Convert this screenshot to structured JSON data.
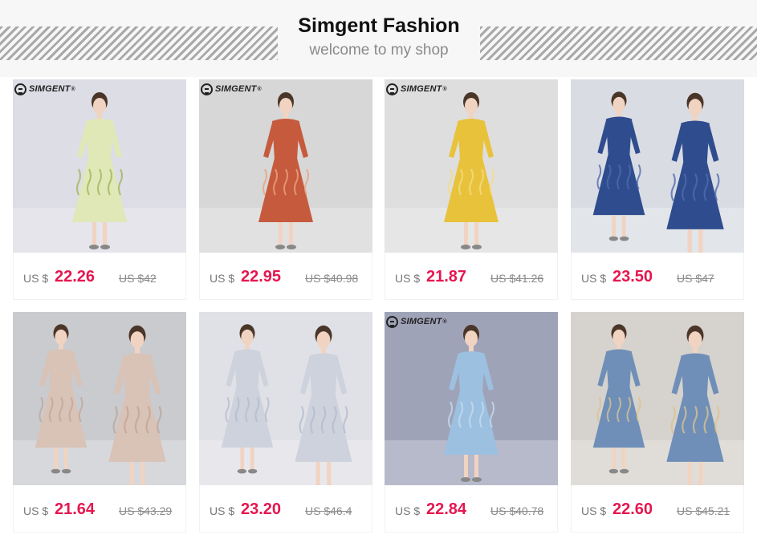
{
  "header": {
    "title": "Simgent Fashion",
    "subtitle": "welcome to my shop"
  },
  "brand_logo_text": "SIMGENT",
  "products": [
    {
      "currency": "US $",
      "price": "22.26",
      "original": "US $42",
      "dress_color": "#dfe8b6",
      "accent": "#9fb55e",
      "bg": "#dcdde5",
      "has_logo": true
    },
    {
      "currency": "US $",
      "price": "22.95",
      "original": "US $40.98",
      "dress_color": "#c65a3d",
      "accent": "#e8a27f",
      "bg": "#d7d7d7",
      "has_logo": true
    },
    {
      "currency": "US $",
      "price": "21.87",
      "original": "US $41.26",
      "dress_color": "#e9c23b",
      "accent": "#f3dc86",
      "bg": "#dedede",
      "has_logo": true
    },
    {
      "currency": "US $",
      "price": "23.50",
      "original": "US $47",
      "dress_color": "#2f4d8e",
      "accent": "#4d6bae",
      "bg": "#d9dce3",
      "has_logo": false
    },
    {
      "currency": "US $",
      "price": "21.64",
      "original": "US $43.29",
      "dress_color": "#d9c2b6",
      "accent": "#bfa597",
      "bg": "#c9cbcf",
      "has_logo": false
    },
    {
      "currency": "US $",
      "price": "23.20",
      "original": "US $46.4",
      "dress_color": "#cdd2dd",
      "accent": "#b3bccd",
      "bg": "#e0e1e6",
      "has_logo": false
    },
    {
      "currency": "US $",
      "price": "22.84",
      "original": "US $40.78",
      "dress_color": "#9cc0e0",
      "accent": "#c4dcf0",
      "bg": "#9fa3b8",
      "has_logo": true
    },
    {
      "currency": "US $",
      "price": "22.60",
      "original": "US $45.21",
      "dress_color": "#6f8fb8",
      "accent": "#d9c38f",
      "bg": "#d6d2cd",
      "has_logo": false
    }
  ]
}
